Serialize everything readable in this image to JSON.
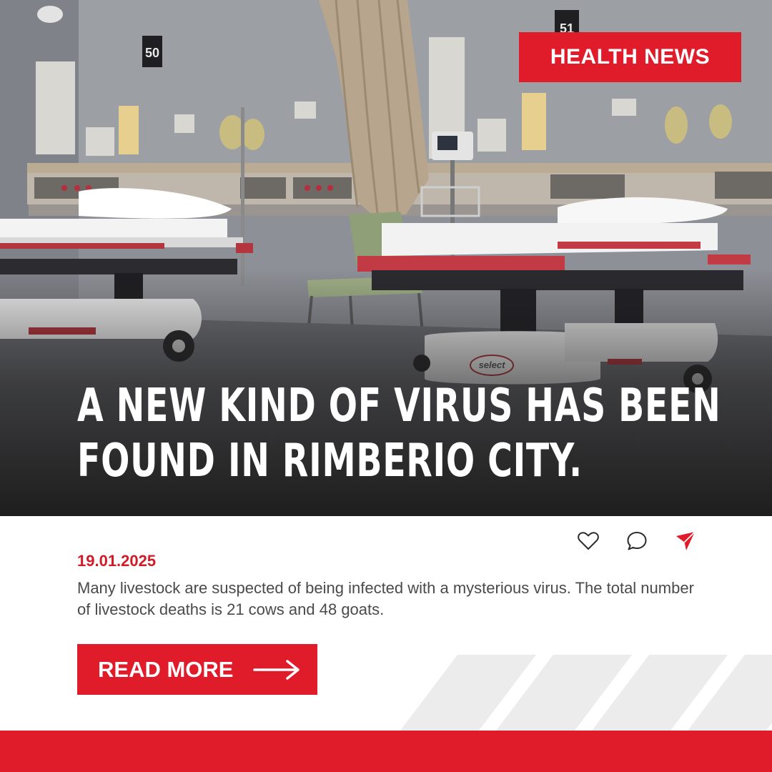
{
  "post": {
    "badge": "HEALTH NEWS",
    "headline_lines": [
      "A NEW KIND OF VIRUS HAS BEEN",
      "FOUND IN RIMBERIO CITY."
    ],
    "date": "19.01.2025",
    "summary": "Many livestock are suspected of being infected with a mysterious virus. The total number of livestock deaths is 21 cows and 48 goats.",
    "cta_label": "READ MORE"
  },
  "photo": {
    "room_signs": [
      "50",
      "51"
    ],
    "stretcher_brand": "select"
  },
  "actions": [
    {
      "name": "like",
      "icon": "heart-icon"
    },
    {
      "name": "comment",
      "icon": "speech-bubble-icon"
    },
    {
      "name": "share",
      "icon": "paper-plane-icon"
    }
  ],
  "icons": {
    "cta": "arrow-right-icon"
  },
  "colors": {
    "brand_red": "#e01b2a",
    "date_red": "#d31b28",
    "text_gray": "#4a4a4a",
    "stripe_gray": "#ececec",
    "footer_red": "#e01b2a"
  }
}
